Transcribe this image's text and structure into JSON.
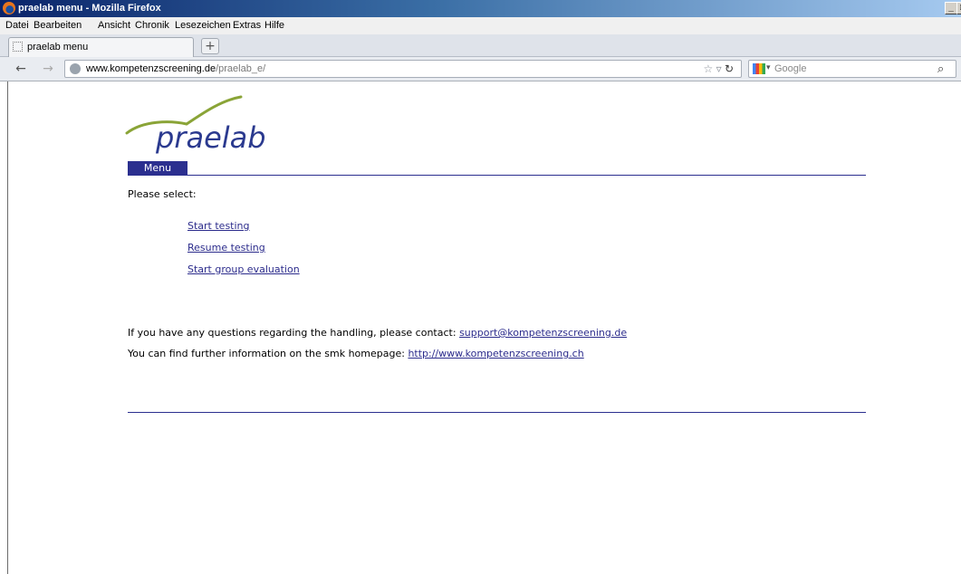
{
  "window": {
    "title": "praelab menu - Mozilla Firefox"
  },
  "menubar": [
    {
      "label": "Datei"
    },
    {
      "label": "Bearbeiten"
    },
    {
      "label": "Ansicht"
    },
    {
      "label": "Chronik"
    },
    {
      "label": "Lesezeichen"
    },
    {
      "label": "Extras"
    },
    {
      "label": "Hilfe"
    }
  ],
  "tab": {
    "label": "praelab menu",
    "new_tab": "+"
  },
  "urlbar": {
    "host": "www.kompetenzscreening.de",
    "path": "/praelab_e/"
  },
  "search": {
    "engine": "Google"
  },
  "page": {
    "logo_text": "praelab",
    "menu_tab": "Menu",
    "prompt": "Please select:",
    "links": [
      "Start testing",
      "Resume testing",
      "Start group evaluation"
    ],
    "contact_text": "If you have any questions regarding the handling, please contact: ",
    "contact_email": "support@kompetenzscreening.de",
    "info_text": "You can find further information on the smk homepage: ",
    "info_url": "http://www.kompetenzscreening.ch"
  },
  "colors": {
    "accent": "#2b2f8f",
    "logo_green": "#8aa437",
    "logo_text": "#2b3a8f"
  }
}
